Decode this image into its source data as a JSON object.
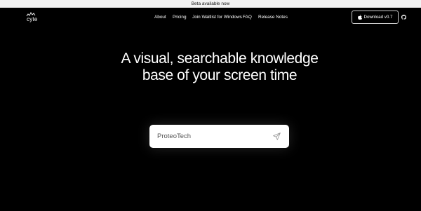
{
  "banner": {
    "text": "Beta available now"
  },
  "brand": {
    "name": "cyte"
  },
  "nav": {
    "items": [
      {
        "label": "About"
      },
      {
        "label": "Pricing"
      },
      {
        "label": "Join Waitlist for Windows"
      },
      {
        "label": "FAQ"
      },
      {
        "label": "Release Notes"
      }
    ]
  },
  "download": {
    "label": "Download v0.7",
    "icon": "apple-icon"
  },
  "github": {
    "icon": "github-icon"
  },
  "hero": {
    "line1": "A visual, searchable knowledge",
    "line2": "base of your screen time"
  },
  "search": {
    "placeholder": "ProteoTech",
    "value": "",
    "icon": "send-icon"
  },
  "colors": {
    "background": "#000000",
    "banner": "#f2f2f2",
    "search_bg": "#ffffff"
  }
}
